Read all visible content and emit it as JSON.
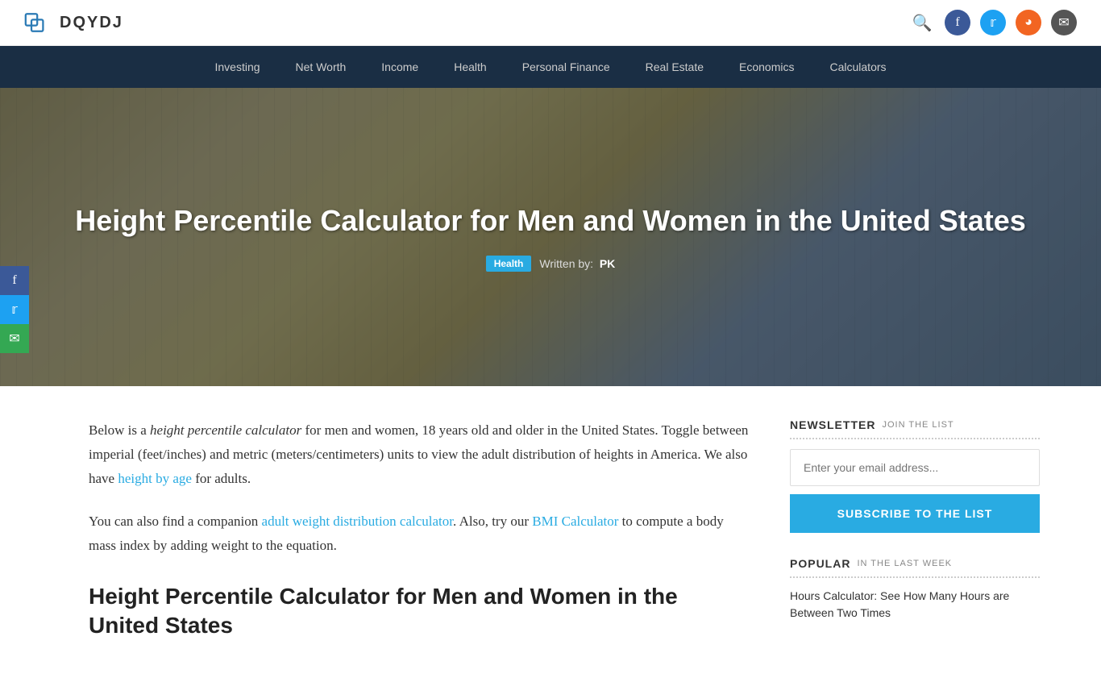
{
  "site": {
    "logo_text": "DQYDJ"
  },
  "header": {
    "icons": [
      {
        "name": "search-icon",
        "symbol": "🔍",
        "label": "Search"
      },
      {
        "name": "facebook-icon",
        "symbol": "f",
        "label": "Facebook",
        "class": "icon-fb"
      },
      {
        "name": "twitter-icon",
        "symbol": "t",
        "label": "Twitter",
        "class": "icon-tw"
      },
      {
        "name": "rss-icon",
        "symbol": "◉",
        "label": "RSS",
        "class": "icon-rss"
      },
      {
        "name": "email-icon",
        "symbol": "✉",
        "label": "Email",
        "class": "icon-email"
      }
    ]
  },
  "nav": {
    "items": [
      {
        "label": "Investing",
        "name": "nav-investing"
      },
      {
        "label": "Net Worth",
        "name": "nav-net-worth"
      },
      {
        "label": "Income",
        "name": "nav-income"
      },
      {
        "label": "Health",
        "name": "nav-health"
      },
      {
        "label": "Personal Finance",
        "name": "nav-personal-finance"
      },
      {
        "label": "Real Estate",
        "name": "nav-real-estate"
      },
      {
        "label": "Economics",
        "name": "nav-economics"
      },
      {
        "label": "Calculators",
        "name": "nav-calculators"
      }
    ]
  },
  "hero": {
    "title": "Height Percentile Calculator for Men and Women in the United States",
    "badge": "Health",
    "written_by_label": "Written by:",
    "author": "PK"
  },
  "social_sidebar": {
    "facebook_label": "f",
    "twitter_label": "t",
    "email_label": "✉"
  },
  "article": {
    "intro_text_1": "Below is a",
    "intro_italic": "height percentile calculator",
    "intro_text_2": "for men and women, 18 years old and older in the United States. Toggle between imperial (feet/inches) and metric (meters/centimeters) units to view the adult distribution of heights in America. We also have",
    "height_by_age_link": "height by age",
    "intro_text_3": "for adults.",
    "companion_text_1": "You can also find a companion",
    "companion_link": "adult weight distribution calculator",
    "companion_text_2": ". Also, try our",
    "bmi_link": "BMI Calculator",
    "companion_text_3": "to compute a body mass index by adding weight to the equation.",
    "section_title": "Height Percentile Calculator for Men and Women in the United States"
  },
  "sidebar": {
    "newsletter": {
      "title": "NEWSLETTER",
      "subtitle": "JOIN THE LIST",
      "placeholder": "Enter your email address...",
      "button_label": "SUBSCRIBE TO THE LIST"
    },
    "popular": {
      "title": "POPULAR",
      "subtitle": "IN THE LAST WEEK",
      "items": [
        {
          "text": "Hours Calculator: See How Many Hours are Between Two Times"
        }
      ]
    }
  }
}
